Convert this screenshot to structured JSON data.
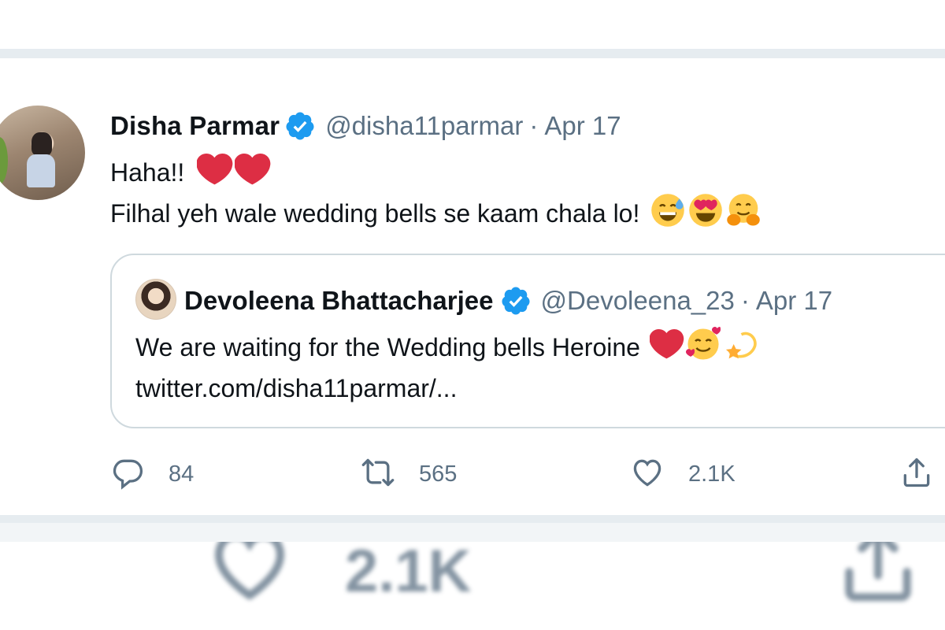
{
  "tweet": {
    "author": {
      "display_name": "Disha Parmar",
      "handle": "@disha11parmar",
      "separator": "·",
      "time": "Apr 17",
      "verified": true
    },
    "text_line1": "Haha!!",
    "text_line1_emojis": [
      "red-heart",
      "red-heart"
    ],
    "text_line2": "Filhal yeh wale wedding bells se kaam chala lo!",
    "text_line2_emojis": [
      "grinning-face-with-sweat",
      "smiling-face-with-heart-eyes",
      "hugging-face"
    ],
    "quote": {
      "author": {
        "display_name": "Devoleena Bhattacharjee",
        "handle": "@Devoleena_23",
        "separator": "·",
        "time": "Apr 17",
        "verified": true
      },
      "text": "We are waiting for the Wedding bells Heroine",
      "text_emojis": [
        "red-heart",
        "smiling-face-with-hearts",
        "dizzy-star"
      ],
      "link": "twitter.com/disha11parmar/..."
    },
    "actions": {
      "reply": {
        "icon": "reply-icon",
        "count": "84"
      },
      "retweet": {
        "icon": "retweet-icon",
        "count": "565"
      },
      "like": {
        "icon": "heart-icon",
        "count": "2.1K"
      },
      "share": {
        "icon": "share-icon"
      }
    }
  },
  "background_blur": {
    "like_count": "2.1K"
  },
  "colors": {
    "text_primary": "#0f1419",
    "text_secondary": "#5b7083",
    "verified_blue": "#1d9bf0",
    "border": "#cfd9de",
    "separator": "#e6ecf0",
    "heart_red": "#e0245e"
  }
}
